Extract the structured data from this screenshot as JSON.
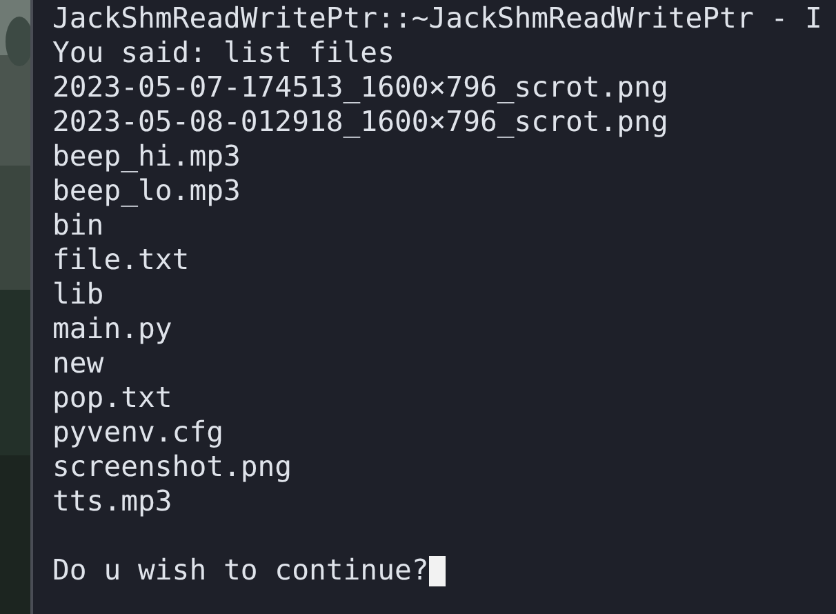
{
  "terminal": {
    "title": "JackShmReadWritePtr::~JackShmReadWritePtr - I",
    "lines": [
      "You said: list files",
      "2023-05-07-174513_1600×796_scrot.png",
      "2023-05-08-012918_1600×796_scrot.png",
      "beep_hi.mp3",
      "beep_lo.mp3",
      "bin",
      "file.txt",
      "lib",
      "main.py",
      "new",
      "pop.txt",
      "pyvenv.cfg",
      "screenshot.png",
      "tts.mp3"
    ],
    "prompt": "Do u wish to continue?",
    "cursor_visible": true
  }
}
